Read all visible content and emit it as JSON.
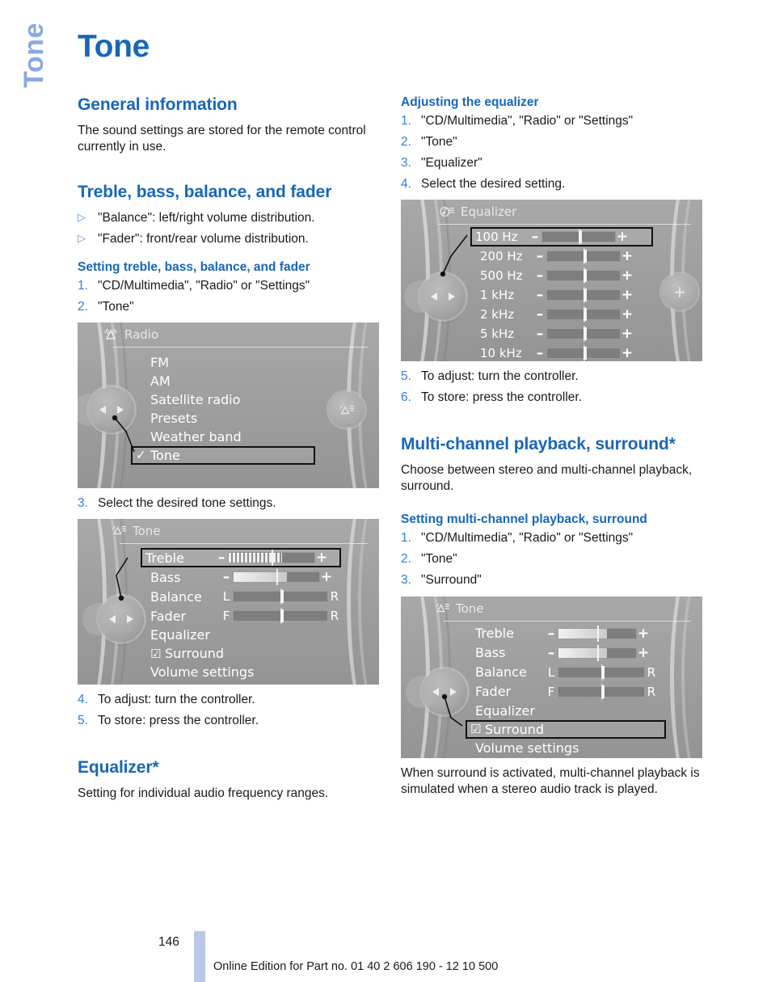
{
  "chapter_tab": "Tone",
  "page_title": "Tone",
  "left_column": {
    "general": {
      "heading": "General information",
      "body": "The sound settings are stored for the remote control currently in use."
    },
    "treble_section": {
      "heading": "Treble, bass, balance, and fader",
      "bullets": [
        "\"Balance\": left/right volume distribution.",
        "\"Fader\": front/rear volume distribution."
      ],
      "sub_heading": "Setting treble, bass, balance, and fader",
      "steps_before": [
        {
          "num": "1.",
          "text": "\"CD/Multimedia\", \"Radio\" or \"Settings\""
        },
        {
          "num": "2.",
          "text": "\"Tone\""
        }
      ],
      "step3": {
        "num": "3.",
        "text": "Select the desired tone settings."
      },
      "steps_after": [
        {
          "num": "4.",
          "text": "To adjust: turn the controller."
        },
        {
          "num": "5.",
          "text": "To store: press the controller."
        }
      ]
    },
    "equalizer": {
      "heading": "Equalizer*",
      "body": "Setting for individual audio frequency ranges."
    }
  },
  "right_column": {
    "adjusting_eq": {
      "sub_heading": "Adjusting the equalizer",
      "steps": [
        {
          "num": "1.",
          "text": "\"CD/Multimedia\", \"Radio\" or \"Settings\""
        },
        {
          "num": "2.",
          "text": "\"Tone\""
        },
        {
          "num": "3.",
          "text": "\"Equalizer\""
        },
        {
          "num": "4.",
          "text": "Select the desired setting."
        }
      ],
      "steps_after": [
        {
          "num": "5.",
          "text": "To adjust: turn the controller."
        },
        {
          "num": "6.",
          "text": "To store: press the controller."
        }
      ]
    },
    "multichannel": {
      "heading": "Multi-channel playback, surround*",
      "body": "Choose between stereo and multi-channel playback, surround.",
      "sub_heading": "Setting multi-channel playback, surround",
      "steps": [
        {
          "num": "1.",
          "text": "\"CD/Multimedia\", \"Radio\" or \"Settings\""
        },
        {
          "num": "2.",
          "text": "\"Tone\""
        },
        {
          "num": "3.",
          "text": "\"Surround\""
        }
      ],
      "closing_body": "When surround is activated, multi-channel playback is simulated when a stereo audio track is played."
    }
  },
  "screenshots": {
    "radio_menu": {
      "title": "Radio",
      "title_icon": "radio-antenna-icon",
      "right_button_icon": "radio-options-icon",
      "items": [
        {
          "label": "FM",
          "checked": false,
          "highlighted": false
        },
        {
          "label": "AM",
          "checked": false,
          "highlighted": false
        },
        {
          "label": "Satellite radio",
          "checked": false,
          "highlighted": false
        },
        {
          "label": "Presets",
          "checked": false,
          "highlighted": false
        },
        {
          "label": "Weather band",
          "checked": false,
          "highlighted": false
        },
        {
          "label": "Tone",
          "checked": true,
          "highlighted": true
        }
      ]
    },
    "tone_treble": {
      "title": "Tone",
      "title_icon": "tone-speaker-icon",
      "rows": [
        {
          "label": "Treble",
          "type": "plusminus",
          "minus": "–",
          "plus": "+",
          "fill": "striped",
          "fill_pct": 62,
          "highlighted": true
        },
        {
          "label": "Bass",
          "type": "plusminus",
          "minus": "–",
          "plus": "+",
          "fill": "solid",
          "fill_pct": 62,
          "highlighted": false
        },
        {
          "label": "Balance",
          "type": "lr",
          "left": "L",
          "right": "R",
          "thumb_pct": 50,
          "highlighted": false
        },
        {
          "label": "Fader",
          "type": "lr",
          "left": "F",
          "right": "R",
          "thumb_pct": 50,
          "highlighted": false
        },
        {
          "label": "Equalizer",
          "type": "plain",
          "highlighted": false
        },
        {
          "label": "Surround",
          "type": "checkbox",
          "checked": true,
          "highlighted": false
        },
        {
          "label": "Volume settings",
          "type": "plain",
          "highlighted": false
        }
      ]
    },
    "equalizer_menu": {
      "title": "Equalizer",
      "title_icon": "equalizer-note-icon",
      "right_button_icon": "plus-icon",
      "right_button_label": "+",
      "bands": [
        {
          "label": "100 Hz",
          "minus": "–",
          "plus": "+",
          "thumb_pct": 50,
          "highlighted": true
        },
        {
          "label": "200 Hz",
          "minus": "–",
          "plus": "+",
          "thumb_pct": 50,
          "highlighted": false
        },
        {
          "label": "500 Hz",
          "minus": "–",
          "plus": "+",
          "thumb_pct": 50,
          "highlighted": false
        },
        {
          "label": "1 kHz",
          "minus": "–",
          "plus": "+",
          "thumb_pct": 50,
          "highlighted": false
        },
        {
          "label": "2 kHz",
          "minus": "–",
          "plus": "+",
          "thumb_pct": 50,
          "highlighted": false
        },
        {
          "label": "5 kHz",
          "minus": "–",
          "plus": "+",
          "thumb_pct": 50,
          "highlighted": false
        },
        {
          "label": "10 kHz",
          "minus": "–",
          "plus": "+",
          "thumb_pct": 50,
          "highlighted": false
        }
      ]
    },
    "tone_surround": {
      "title": "Tone",
      "title_icon": "tone-speaker-icon",
      "rows": [
        {
          "label": "Treble",
          "type": "plusminus",
          "minus": "–",
          "plus": "+",
          "fill": "solid",
          "fill_pct": 62,
          "highlighted": false
        },
        {
          "label": "Bass",
          "type": "plusminus",
          "minus": "–",
          "plus": "+",
          "fill": "solid",
          "fill_pct": 62,
          "highlighted": false
        },
        {
          "label": "Balance",
          "type": "lr",
          "left": "L",
          "right": "R",
          "thumb_pct": 50,
          "highlighted": false
        },
        {
          "label": "Fader",
          "type": "lr",
          "left": "F",
          "right": "R",
          "thumb_pct": 50,
          "highlighted": false
        },
        {
          "label": "Equalizer",
          "type": "plain",
          "highlighted": false
        },
        {
          "label": "Surround",
          "type": "checkbox",
          "checked": true,
          "highlighted": true
        },
        {
          "label": "Volume settings",
          "type": "plain",
          "highlighted": false
        }
      ]
    }
  },
  "footer": {
    "page_number": "146",
    "text": "Online Edition for Part no. 01 40 2 606 190 - 12 10 500"
  },
  "colors": {
    "heading_blue": "#1866b8",
    "tab_blue": "#8ba9df",
    "step_blue": "#2f7fd4",
    "footer_bar": "#b9c8e8"
  }
}
